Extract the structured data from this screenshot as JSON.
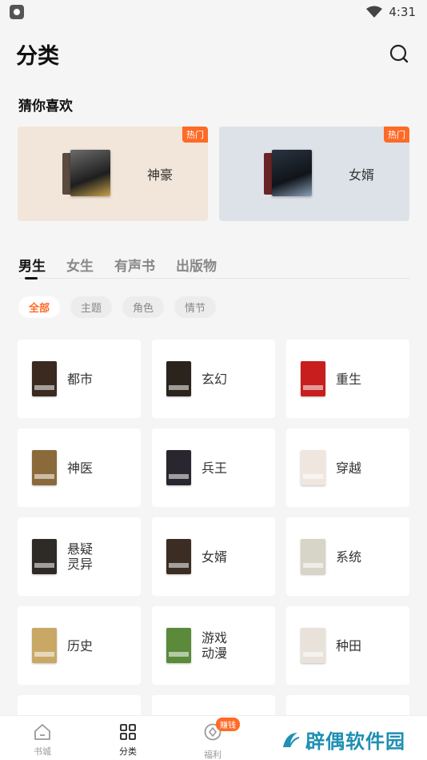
{
  "status_bar": {
    "time": "4:31"
  },
  "header": {
    "title": "分类"
  },
  "guess": {
    "title": "猜你喜欢",
    "cards": [
      {
        "label": "神豪",
        "badge": "热门",
        "bg": "#f2e6da"
      },
      {
        "label": "女婿",
        "badge": "热门",
        "bg": "#dde2e9"
      }
    ]
  },
  "tabs": [
    {
      "label": "男生",
      "active": true
    },
    {
      "label": "女生",
      "active": false
    },
    {
      "label": "有声书",
      "active": false
    },
    {
      "label": "出版物",
      "active": false
    }
  ],
  "chips": [
    {
      "label": "全部",
      "active": true
    },
    {
      "label": "主题",
      "active": false
    },
    {
      "label": "角色",
      "active": false
    },
    {
      "label": "情节",
      "active": false
    }
  ],
  "categories": [
    {
      "label": "都市",
      "cover": "#3a2a20"
    },
    {
      "label": "玄幻",
      "cover": "#2b241c"
    },
    {
      "label": "重生",
      "cover": "#c81e1e"
    },
    {
      "label": "神医",
      "cover": "#8a6a3a"
    },
    {
      "label": "兵王",
      "cover": "#2a2630"
    },
    {
      "label": "穿越",
      "cover": "#efe6e0"
    },
    {
      "label": "悬疑灵异",
      "cover": "#2e2a26"
    },
    {
      "label": "女婿",
      "cover": "#3b2d24"
    },
    {
      "label": "系统",
      "cover": "#d7d4c8"
    },
    {
      "label": "历史",
      "cover": "#c9a866"
    },
    {
      "label": "游戏动漫",
      "cover": "#5a8a3a"
    },
    {
      "label": "种田",
      "cover": "#e9e2da"
    }
  ],
  "bottom_nav": {
    "items": [
      {
        "label": "书城",
        "active": false
      },
      {
        "label": "分类",
        "active": true
      },
      {
        "label": "福利",
        "active": false,
        "badge": "赚钱"
      }
    ]
  },
  "watermark": {
    "text": "辟偶软件园"
  },
  "colors": {
    "accent": "#ff6a26",
    "watermark": "#1f8fb2"
  }
}
